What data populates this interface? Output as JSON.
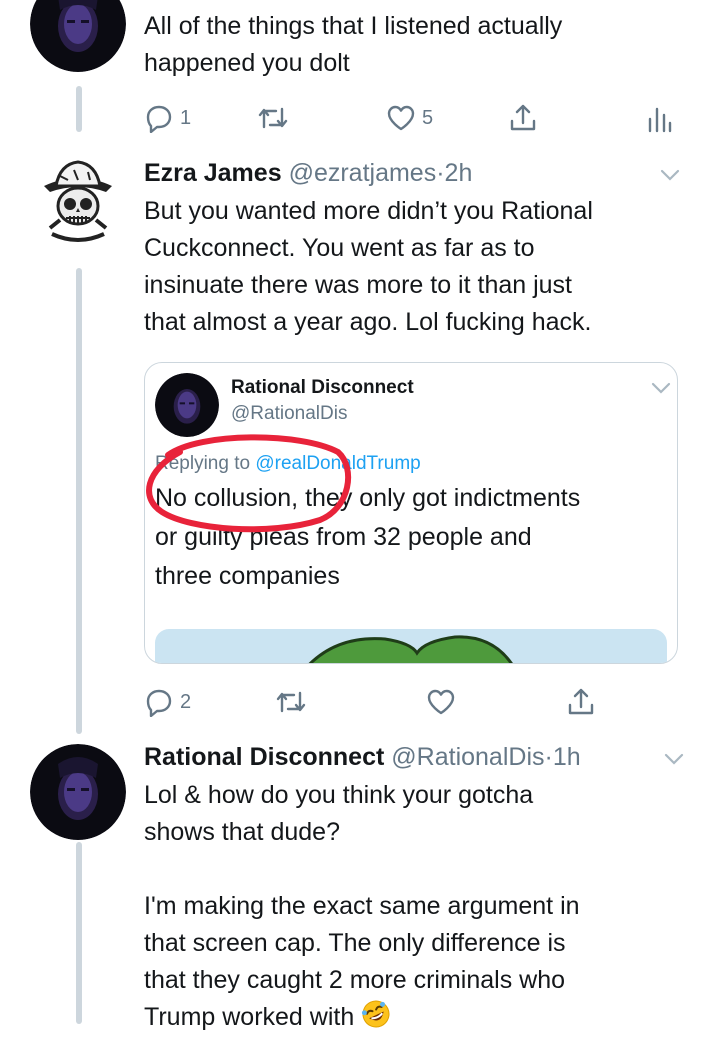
{
  "tweets": [
    {
      "text": "All of the things that I listened actually\nhappened you dolt",
      "actions": {
        "reply_count": "1",
        "like_count": "5"
      },
      "avatar_icon": "dark-portrait-avatar"
    },
    {
      "name": "Ezra James",
      "handle": "@ezratjames",
      "separator": "·",
      "time": "2h",
      "avatar_icon": "skull-bucket-hat-avatar",
      "text": "But you wanted more didn’t you Rational\nCuckconnect. You went as far as to\ninsinuate there was more to it than just\nthat almost a year ago. Lol fucking hack.",
      "quote": {
        "name": "Rational Disconnect",
        "handle": "@RationalDis",
        "replying_prefix": "Replying to",
        "replying_mention": "@realDonaldTrump",
        "text": "No collusion, they only got indictments\nor guilty pleas from 32 people and\nthree companies"
      },
      "actions": {
        "reply_count": "2",
        "like_count": ""
      }
    },
    {
      "name": "Rational Disconnect",
      "handle": "@RationalDis",
      "separator": "·",
      "time": "1h",
      "avatar_icon": "dark-portrait-avatar",
      "text": "Lol & how do you think your gotcha\nshows that dude?\n\nI'm making the exact same argument in\nthat screen cap. The only difference is\nthat they caught 2 more criminals who\nTrump worked with",
      "emoji": "rolling-on-floor-laughing-emoji"
    }
  ],
  "colors": {
    "text": "#14171a",
    "secondary": "#657786",
    "link": "#1da1f2",
    "thread_line": "#cdd6dd",
    "annotation_circle": "#e8233a"
  }
}
